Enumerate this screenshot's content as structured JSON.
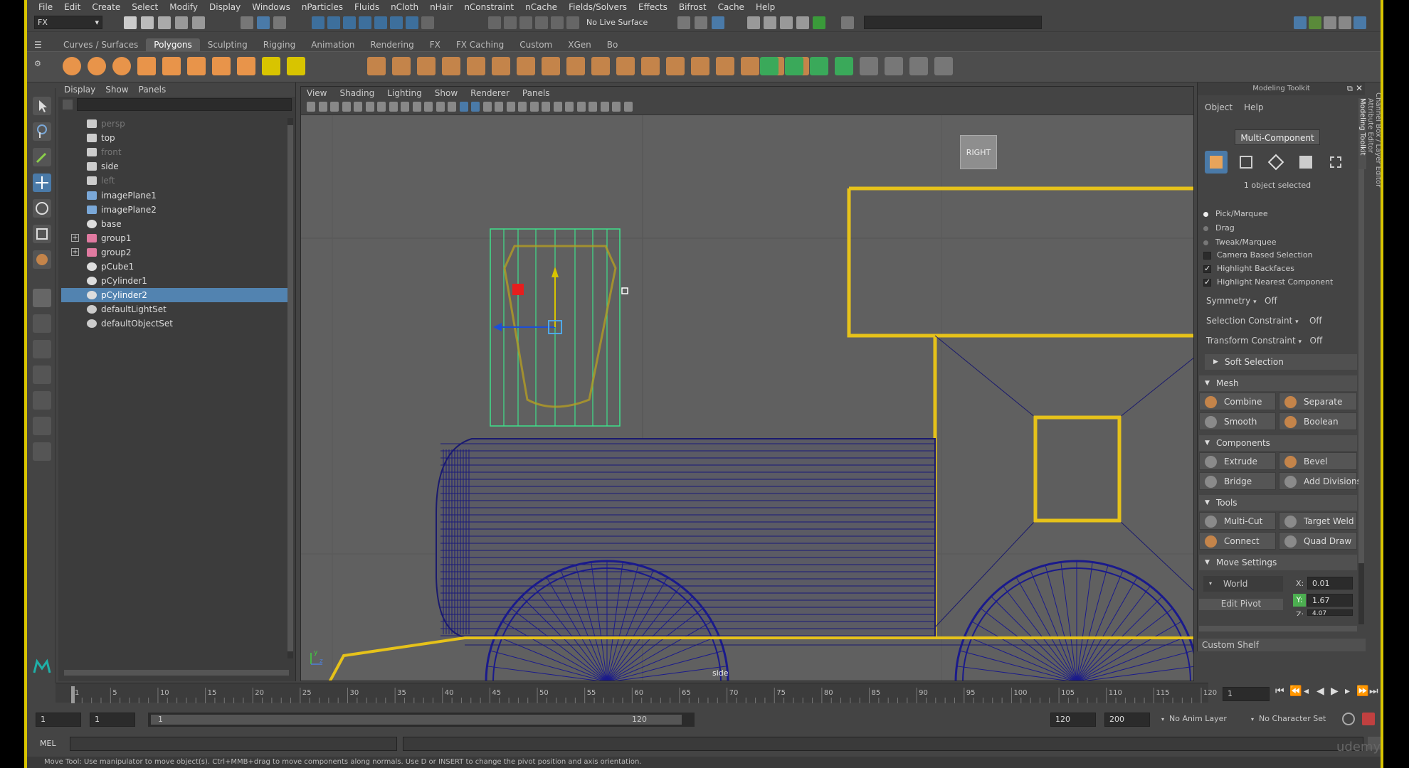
{
  "menus": [
    "File",
    "Edit",
    "Create",
    "Select",
    "Modify",
    "Display",
    "Windows",
    "nParticles",
    "Fluids",
    "nCloth",
    "nHair",
    "nConstraint",
    "nCache",
    "Fields/Solvers",
    "Effects",
    "Bifrost",
    "Cache",
    "Help"
  ],
  "status": {
    "mode": "FX",
    "live_surface": "No Live Surface"
  },
  "shelf_tabs": [
    "Curves / Surfaces",
    "Polygons",
    "Sculpting",
    "Rigging",
    "Animation",
    "Rendering",
    "FX",
    "FX Caching",
    "Custom",
    "XGen",
    "Bo"
  ],
  "shelf_active": "Polygons",
  "outliner": {
    "menu": [
      "Display",
      "Show",
      "Panels"
    ],
    "items": [
      {
        "label": "persp",
        "icon": "camera-icon",
        "state": "dim"
      },
      {
        "label": "top",
        "icon": "camera-icon",
        "state": ""
      },
      {
        "label": "front",
        "icon": "camera-icon",
        "state": "dim"
      },
      {
        "label": "side",
        "icon": "camera-icon",
        "state": ""
      },
      {
        "label": "left",
        "icon": "camera-icon",
        "state": "dim"
      },
      {
        "label": "imagePlane1",
        "icon": "image-plane-icon",
        "state": ""
      },
      {
        "label": "imagePlane2",
        "icon": "image-plane-icon",
        "state": ""
      },
      {
        "label": "base",
        "icon": "mesh-icon",
        "state": ""
      },
      {
        "label": "group1",
        "icon": "group-icon",
        "state": "",
        "expand": true
      },
      {
        "label": "group2",
        "icon": "group-icon",
        "state": "",
        "expand": true
      },
      {
        "label": "pCube1",
        "icon": "mesh-icon",
        "state": ""
      },
      {
        "label": "pCylinder1",
        "icon": "mesh-icon",
        "state": ""
      },
      {
        "label": "pCylinder2",
        "icon": "mesh-icon",
        "state": "selected"
      },
      {
        "label": "defaultLightSet",
        "icon": "set-icon",
        "state": ""
      },
      {
        "label": "defaultObjectSet",
        "icon": "set-icon",
        "state": ""
      }
    ]
  },
  "viewport": {
    "menu": [
      "View",
      "Shading",
      "Lighting",
      "Show",
      "Renderer",
      "Panels"
    ],
    "cube_label": "RIGHT",
    "camera_label": "side"
  },
  "toolkit": {
    "title": "Modeling Toolkit",
    "menu": [
      "Object",
      "Help"
    ],
    "mode_label": "Multi-Component",
    "selected_text": "1 object selected",
    "pick": [
      "Pick/Marquee",
      "Drag",
      "Tweak/Marquee"
    ],
    "checks": [
      {
        "label": "Camera Based Selection",
        "on": false
      },
      {
        "label": "Highlight Backfaces",
        "on": true
      },
      {
        "label": "Highlight Nearest Component",
        "on": true
      }
    ],
    "symmetry": {
      "label": "Symmetry",
      "value": "Off"
    },
    "sel_constraint": {
      "label": "Selection Constraint",
      "value": "Off"
    },
    "xform_constraint": {
      "label": "Transform Constraint",
      "value": "Off"
    },
    "soft_selection": "Soft Selection",
    "mesh_title": "Mesh",
    "mesh": [
      "Combine",
      "Separate",
      "Smooth",
      "Boolean"
    ],
    "comp_title": "Components",
    "components": [
      "Extrude",
      "Bevel",
      "Bridge",
      "Add Divisions"
    ],
    "tools_title": "Tools",
    "tools": [
      "Multi-Cut",
      "Target Weld",
      "Connect",
      "Quad Draw"
    ],
    "move_title": "Move Settings",
    "world": "World",
    "edit_pivot": "Edit Pivot",
    "x": "0.01",
    "y": "1.67",
    "z": "4.07",
    "custom_shelf": "Custom Shelf",
    "side_tabs": [
      "Channel Box / Layer Editor",
      "Attribute Editor",
      "Modeling Toolkit"
    ]
  },
  "timeline": {
    "ticks": [
      "1",
      "5",
      "10",
      "15",
      "20",
      "25",
      "30",
      "35",
      "40",
      "45",
      "50",
      "55",
      "60",
      "65",
      "70",
      "75",
      "80",
      "85",
      "90",
      "95",
      "100",
      "105",
      "110",
      "115",
      "120"
    ],
    "current": "1"
  },
  "range": {
    "start": "1",
    "start2": "1",
    "slider_start": "1",
    "slider_end": "120",
    "end": "120",
    "end2": "200",
    "anim_layer": "No Anim Layer",
    "char_set": "No Character Set"
  },
  "cmd": {
    "label": "MEL"
  },
  "help_line": "Move Tool: Use manipulator to move object(s). Ctrl+MMB+drag to move components along normals. Use D or INSERT to change the pivot position and axis orientation.",
  "watermark": "udemy",
  "colors": {
    "selection_yellow": "#e6c21a",
    "wire_blue": "#1a1a8c",
    "selected_row": "#5283b0",
    "accent": "#d8c400"
  }
}
